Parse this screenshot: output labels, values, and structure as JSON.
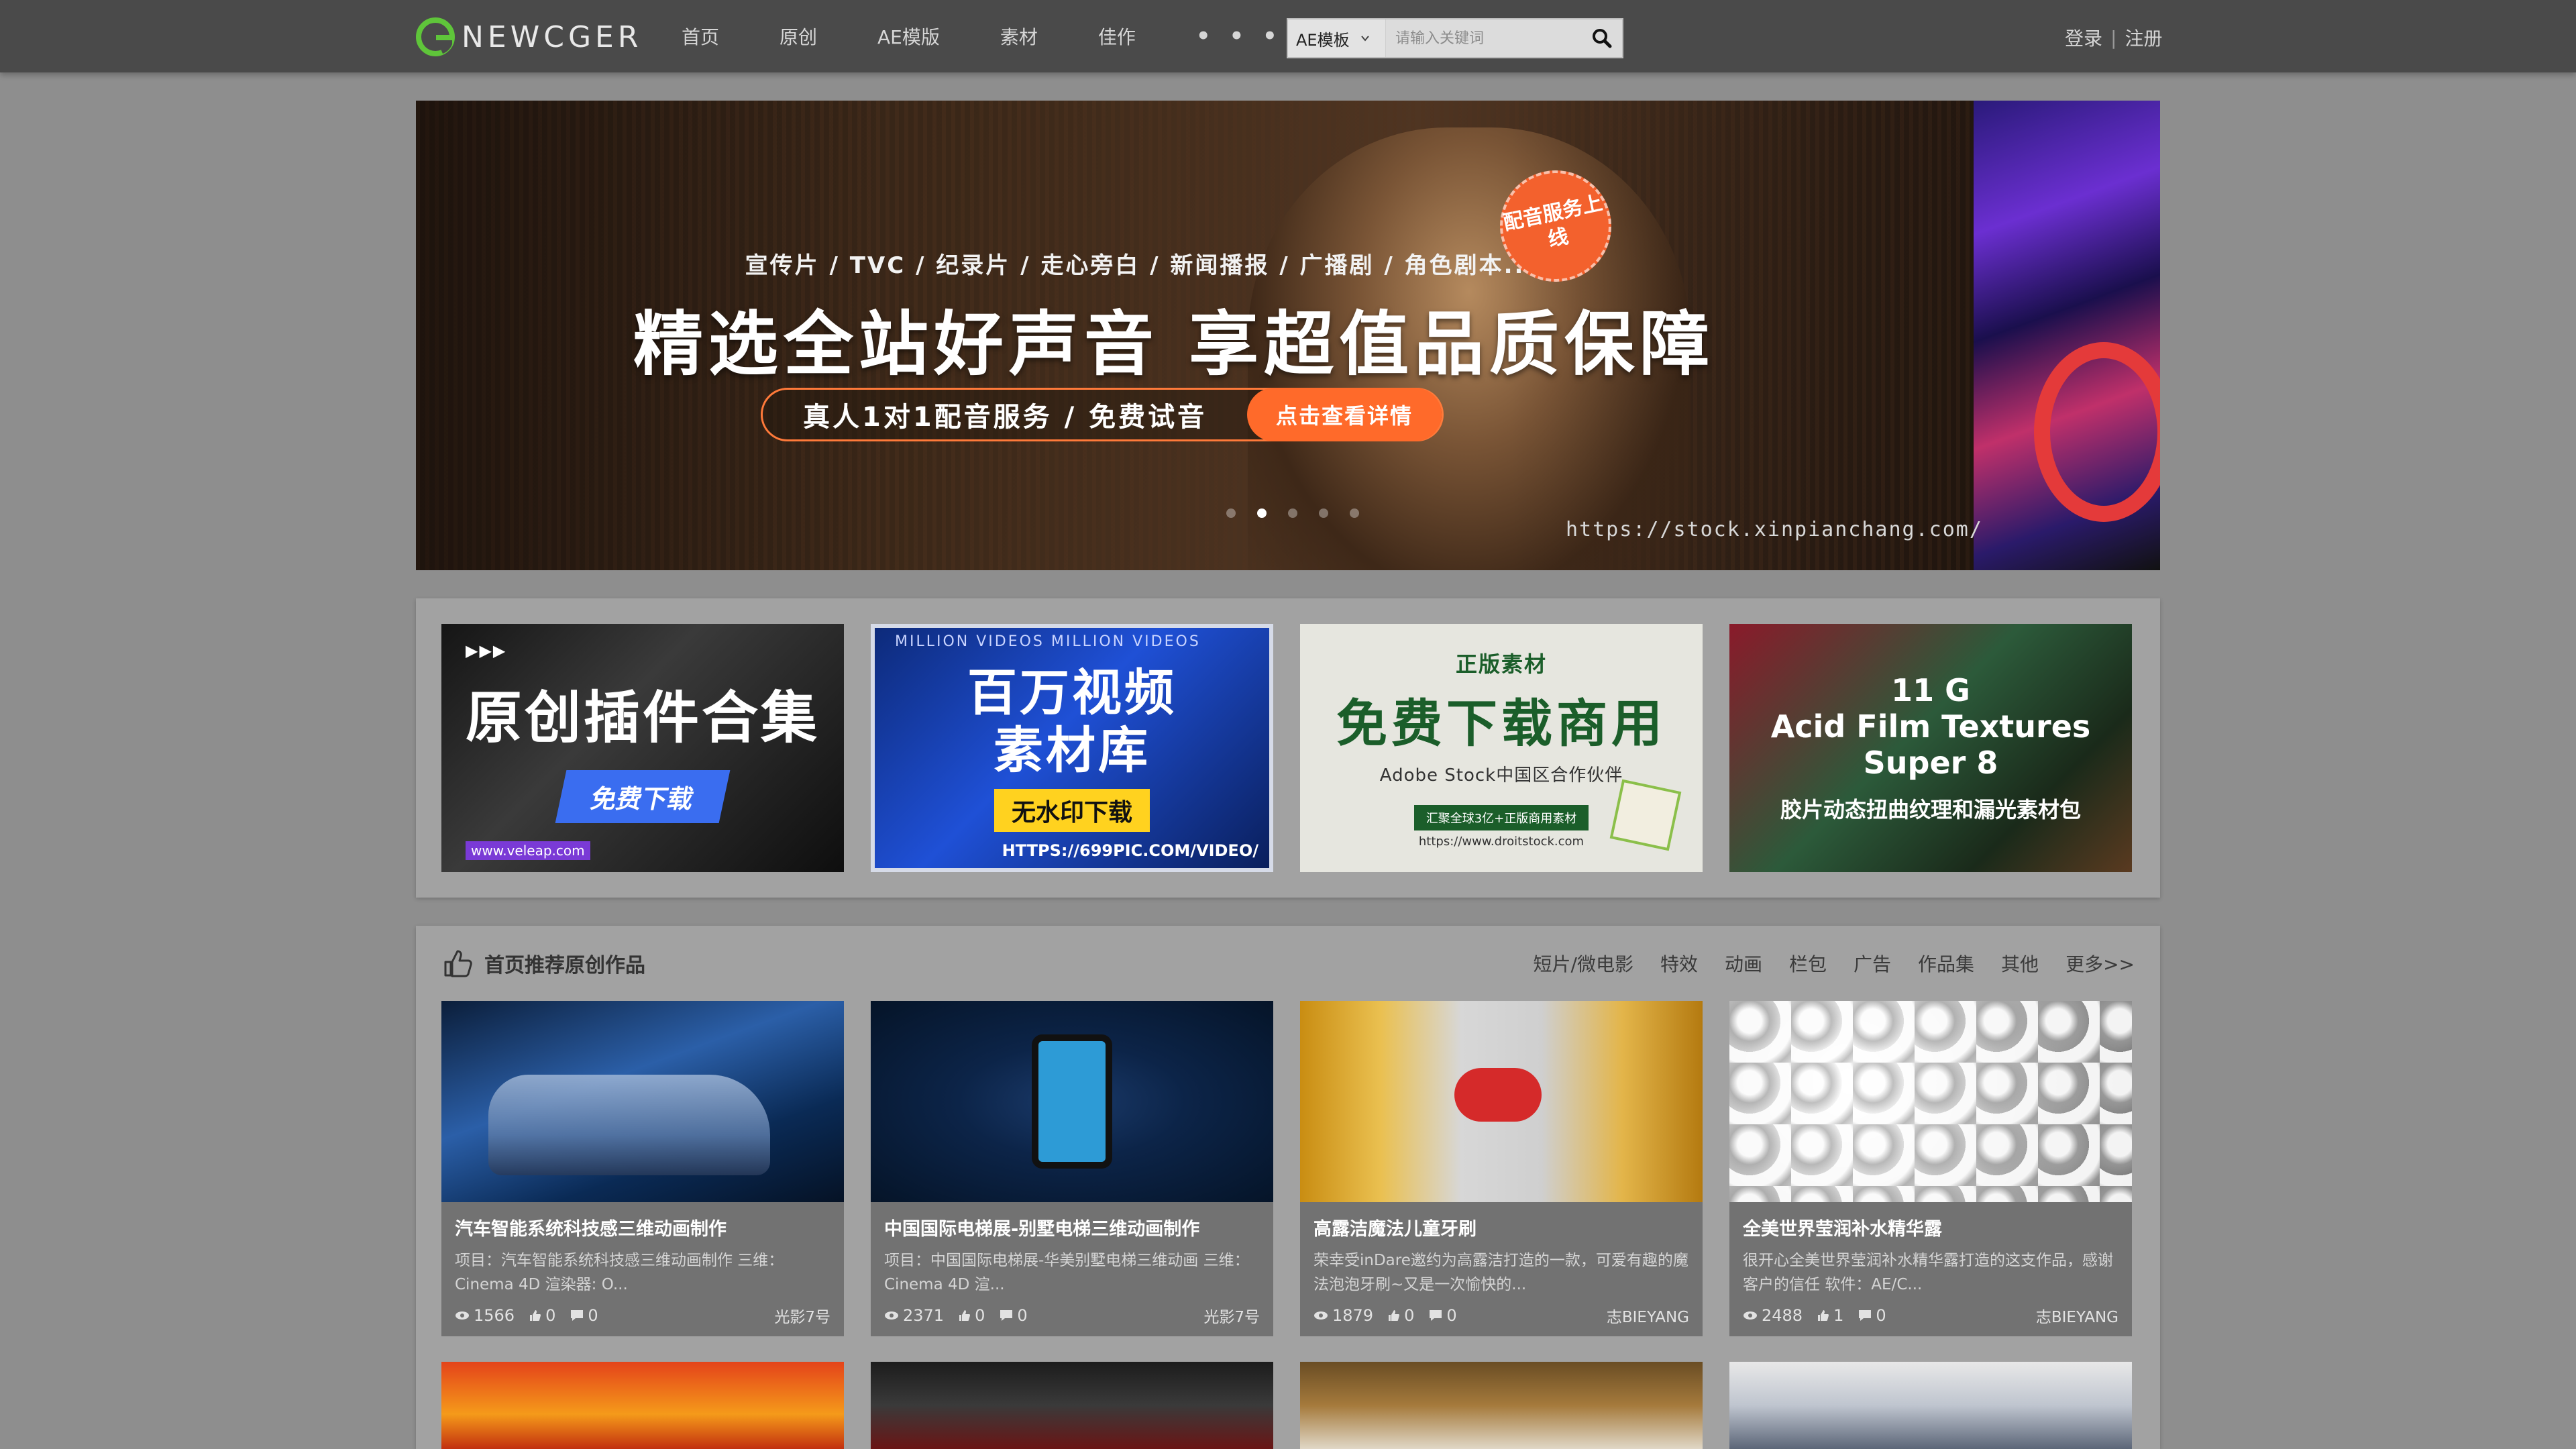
{
  "header": {
    "logo_text": "NEWCGER",
    "nav": [
      "首页",
      "原创",
      "AE模版",
      "素材",
      "佳作",
      "• • •"
    ],
    "search": {
      "category": "AE模板",
      "placeholder": "请输入关键词"
    },
    "auth": {
      "login": "登录",
      "separator": "|",
      "register": "注册"
    }
  },
  "banner": {
    "subtitle": "宣传片 / TVC / 纪录片 / 走心旁白 / 新闻播报 / 广播剧 / 角色剧本...",
    "headline": "精选全站好声音  享超值品质保障",
    "pill_text": "真人1对1配音服务 / 免费试音",
    "cta": "点击查看详情",
    "badge": "配音服务上线",
    "url": "https://stock.xinpianchang.com/",
    "slide_count": 5,
    "active_slide": 2
  },
  "ads": [
    {
      "arrows": "▶▶▶",
      "big": "原创插件合集",
      "button": "免费下载",
      "foot": "www.veleap.com"
    },
    {
      "top": "MILLION VIDEOS MILLION VIDEOS",
      "big_line1": "百万视频",
      "big_line2": "素材库",
      "button": "无水印下载",
      "foot": "HTTPS://699PIC.COM/VIDEO/"
    },
    {
      "small": "正版素材",
      "big": "免费下载商用",
      "mid": "Adobe Stock中国区合作伙伴",
      "tag": "汇聚全球3亿+正版商用素材",
      "url": "https://www.droitstock.com"
    },
    {
      "line1": "11 G",
      "line2": "Acid Film Textures",
      "line3": "Super 8",
      "sub": "胶片动态扭曲纹理和漏光素材包"
    }
  ],
  "works": {
    "title": "首页推荐原创作品",
    "filters": [
      "短片/微电影",
      "特效",
      "动画",
      "栏包",
      "广告",
      "作品集",
      "其他",
      "更多>>"
    ],
    "cards": [
      {
        "title": "汽车智能系统科技感三维动画制作",
        "desc": "项目：汽车智能系统科技感三维动画制作 三维：Cinema 4D 渲染器: O...",
        "views": "1566",
        "likes": "0",
        "comments": "0",
        "author": "光影7号"
      },
      {
        "title": "中国国际电梯展-别墅电梯三维动画制作",
        "desc": "项目：中国国际电梯展-华美别墅电梯三维动画 三维： Cinema 4D 渲...",
        "views": "2371",
        "likes": "0",
        "comments": "0",
        "author": "光影7号"
      },
      {
        "title": "高露洁魔法儿童牙刷",
        "desc": "荣幸受inDare邀约为高露洁打造的一款，可爱有趣的魔法泡泡牙刷~又是一次愉快的...",
        "views": "1879",
        "likes": "0",
        "comments": "0",
        "author": "志BIEYANG"
      },
      {
        "title": "全美世界莹润补水精华露",
        "desc": "很开心全美世界莹润补水精华露打造的这支作品，感谢客户的信任 软件：AE/C...",
        "views": "2488",
        "likes": "1",
        "comments": "0",
        "author": "志BIEYANG"
      }
    ]
  },
  "colors": {
    "header_bg": "#4a4a4a",
    "page_bg": "#8e8e8e",
    "accent_orange": "#ff6a2a",
    "logo_green": "#4caf2a"
  }
}
